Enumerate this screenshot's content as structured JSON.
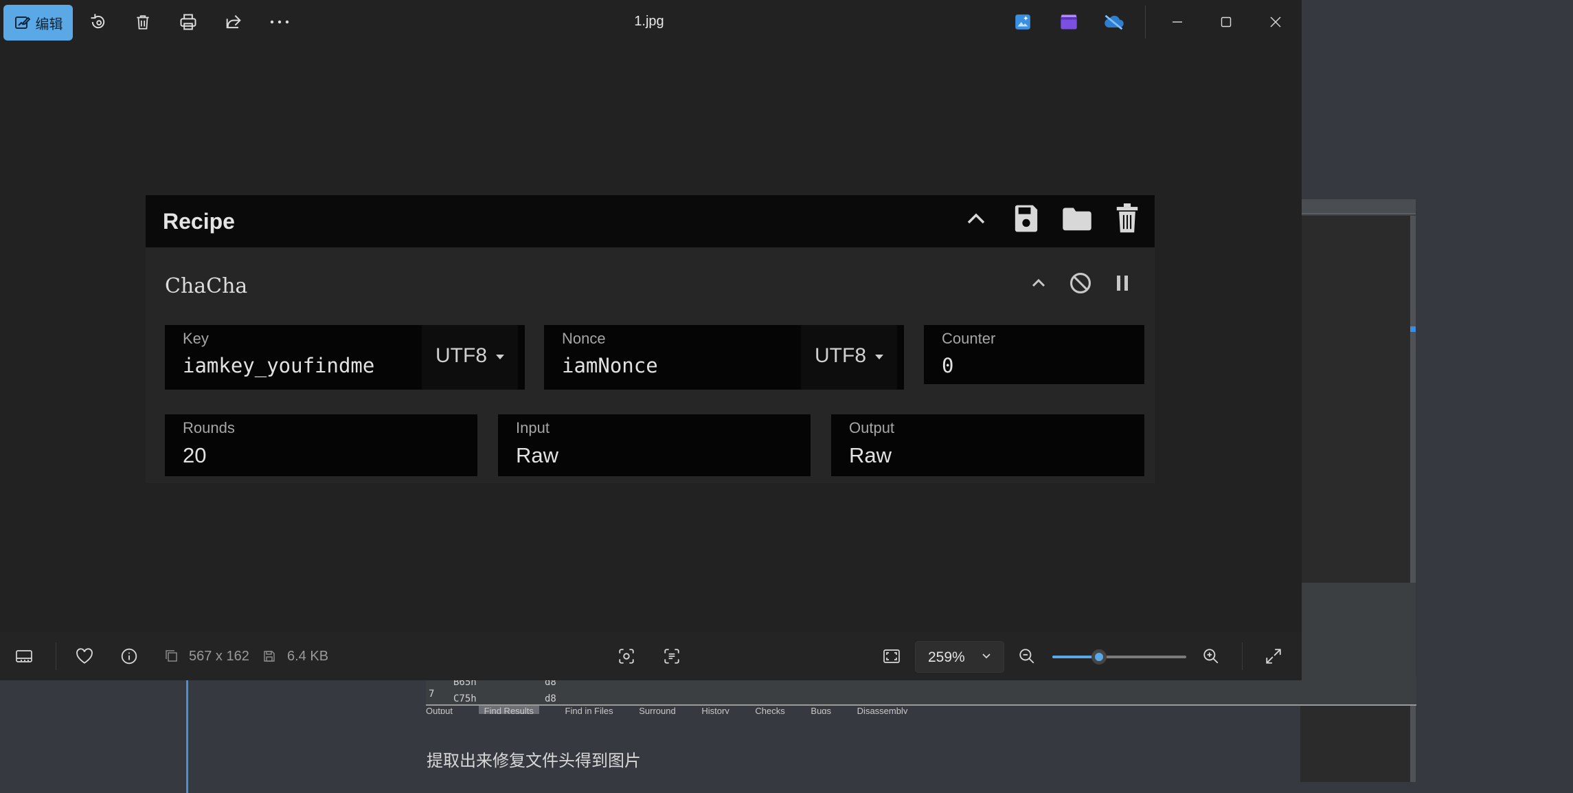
{
  "viewer": {
    "edit_label": "编辑",
    "file_name": "1.jpg",
    "image_dimensions": "567 x 162",
    "file_size": "6.4 KB",
    "zoom_value": "259%",
    "zoom_fraction": 0.35,
    "accent_color": "#5aa9e6"
  },
  "recipe": {
    "title": "Recipe",
    "operation": {
      "name": "ChaCha",
      "key": {
        "label": "Key",
        "value": "iamkey_youfindme",
        "encoding": "UTF8"
      },
      "nonce": {
        "label": "Nonce",
        "value": "iamNonce",
        "encoding": "UTF8"
      },
      "counter": {
        "label": "Counter",
        "value": "0"
      },
      "rounds": {
        "label": "Rounds",
        "value": "20"
      },
      "input": {
        "label": "Input",
        "value": "Raw"
      },
      "output": {
        "label": "Output",
        "value": "Raw"
      }
    }
  },
  "background": {
    "code_lines": [
      {
        "row": "",
        "addr": "B65h",
        "val": "d8"
      },
      {
        "row": "7",
        "addr": "C75h",
        "val": "d8"
      }
    ],
    "tabs": [
      "Output",
      "Find Results",
      "Find in Files",
      "Surround",
      "History",
      "Checks",
      "Bugs",
      "Disassembly"
    ],
    "caption": "提取出来修复文件头得到图片"
  }
}
